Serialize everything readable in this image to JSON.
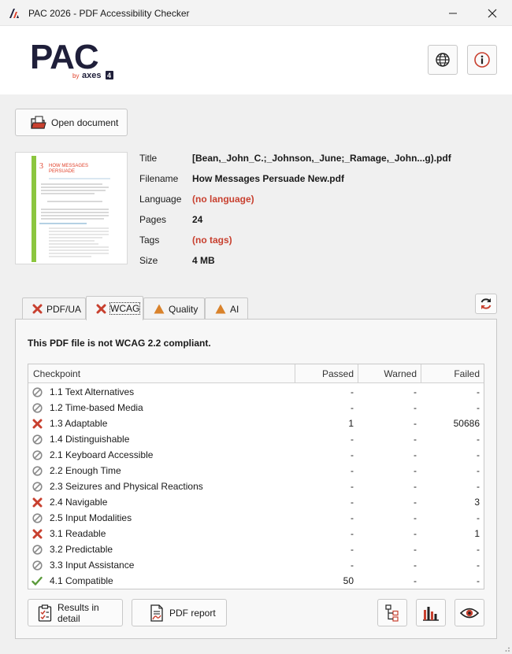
{
  "window": {
    "title": "PAC 2026 - PDF Accessibility Checker"
  },
  "header": {
    "logo_main": "PAC",
    "logo_by": "by",
    "logo_brand": "axes",
    "logo_badge": "4"
  },
  "toolbar": {
    "open_document": "Open document"
  },
  "document": {
    "fields": [
      {
        "label": "Title",
        "value": "[Bean,_John_C.;_Johnson,_June;_Ramage,_John...g).pdf",
        "status": "normal"
      },
      {
        "label": "Filename",
        "value": "How Messages Persuade New.pdf",
        "status": "normal"
      },
      {
        "label": "Language",
        "value": "(no language)",
        "status": "error"
      },
      {
        "label": "Pages",
        "value": "24",
        "status": "normal"
      },
      {
        "label": "Tags",
        "value": "(no tags)",
        "status": "error"
      },
      {
        "label": "Size",
        "value": "4 MB",
        "status": "normal"
      }
    ],
    "thumbnail": {
      "chapter_number": "3",
      "chapter_title_line1": "HOW MESSAGES",
      "chapter_title_line2": "PERSUADE"
    }
  },
  "tabs": [
    {
      "label": "PDF/UA",
      "icon": "x-icon",
      "active": false
    },
    {
      "label": "WCAG",
      "icon": "x-icon",
      "active": true
    },
    {
      "label": "Quality",
      "icon": "warning-icon",
      "active": false
    },
    {
      "label": "AI",
      "icon": "warning-icon",
      "active": false
    }
  ],
  "wcag": {
    "compliance_text": "This PDF file is not WCAG 2.2 compliant.",
    "columns": {
      "checkpoint": "Checkpoint",
      "passed": "Passed",
      "warned": "Warned",
      "failed": "Failed"
    },
    "rows": [
      {
        "status": "na",
        "name": "1.1 Text Alternatives",
        "passed": "-",
        "warned": "-",
        "failed": "-"
      },
      {
        "status": "na",
        "name": "1.2 Time-based Media",
        "passed": "-",
        "warned": "-",
        "failed": "-"
      },
      {
        "status": "fail",
        "name": "1.3 Adaptable",
        "passed": "1",
        "warned": "-",
        "failed": "50686"
      },
      {
        "status": "na",
        "name": "1.4 Distinguishable",
        "passed": "-",
        "warned": "-",
        "failed": "-"
      },
      {
        "status": "na",
        "name": "2.1 Keyboard Accessible",
        "passed": "-",
        "warned": "-",
        "failed": "-"
      },
      {
        "status": "na",
        "name": "2.2 Enough Time",
        "passed": "-",
        "warned": "-",
        "failed": "-"
      },
      {
        "status": "na",
        "name": "2.3 Seizures and Physical Reactions",
        "passed": "-",
        "warned": "-",
        "failed": "-"
      },
      {
        "status": "fail",
        "name": "2.4 Navigable",
        "passed": "-",
        "warned": "-",
        "failed": "3"
      },
      {
        "status": "na",
        "name": "2.5 Input Modalities",
        "passed": "-",
        "warned": "-",
        "failed": "-"
      },
      {
        "status": "fail",
        "name": "3.1 Readable",
        "passed": "-",
        "warned": "-",
        "failed": "1"
      },
      {
        "status": "na",
        "name": "3.2 Predictable",
        "passed": "-",
        "warned": "-",
        "failed": "-"
      },
      {
        "status": "na",
        "name": "3.3 Input Assistance",
        "passed": "-",
        "warned": "-",
        "failed": "-"
      },
      {
        "status": "pass",
        "name": "4.1 Compatible",
        "passed": "50",
        "warned": "-",
        "failed": "-"
      }
    ]
  },
  "actions": {
    "results_in_detail": "Results in detail",
    "pdf_report": "PDF report"
  },
  "colors": {
    "error": "#c8402f",
    "warning": "#d9822b",
    "success": "#5a9a3a",
    "brand_dark": "#1f1f3a",
    "brand_accent": "#e0402a"
  }
}
